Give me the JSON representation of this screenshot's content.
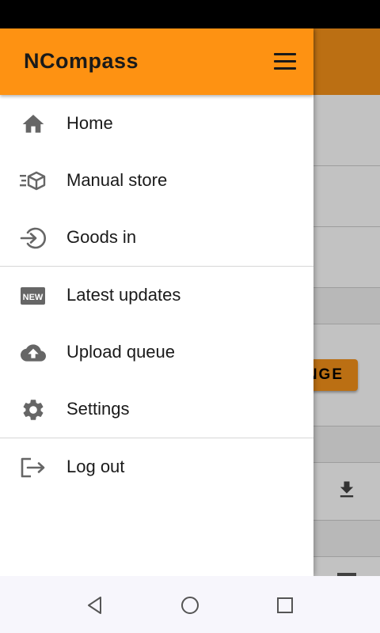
{
  "drawer": {
    "title": "NCompass",
    "menu_icon": "menu-icon",
    "items": [
      {
        "label": "Home",
        "icon": "home-icon"
      },
      {
        "label": "Manual store",
        "icon": "box-icon"
      },
      {
        "label": "Goods in",
        "icon": "login-icon"
      },
      {
        "label": "Latest updates",
        "icon": "new-badge-icon"
      },
      {
        "label": "Upload queue",
        "icon": "cloud-upload-icon"
      },
      {
        "label": "Settings",
        "icon": "gear-icon"
      },
      {
        "label": "Log out",
        "icon": "logout-icon"
      }
    ],
    "new_badge_text": "NEW"
  },
  "background": {
    "button_label_visible": "NGE"
  },
  "colors": {
    "accent": "#fe9212",
    "icon": "#666666",
    "text": "#1a1a1a"
  },
  "nav": {
    "back": "back-icon",
    "home": "home-circle-icon",
    "recents": "recents-square-icon"
  }
}
